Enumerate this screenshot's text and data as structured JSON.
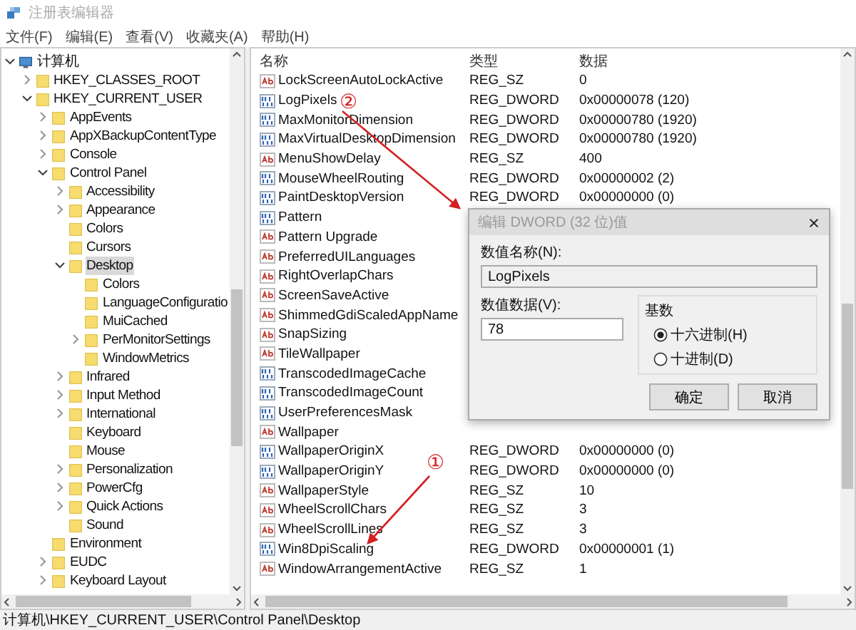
{
  "window": {
    "title": "注册表编辑器"
  },
  "menu": [
    "文件(F)",
    "编辑(E)",
    "查看(V)",
    "收藏夹(A)",
    "帮助(H)"
  ],
  "tree": {
    "label": "计算机",
    "kind": "computer",
    "expanded": true,
    "selected": false,
    "children": [
      {
        "label": "HKEY_CLASSES_ROOT",
        "expanded": false,
        "selected": false
      },
      {
        "label": "HKEY_CURRENT_USER",
        "expanded": true,
        "selected": false,
        "children": [
          {
            "label": "AppEvents",
            "expanded": false,
            "selected": false
          },
          {
            "label": "AppXBackupContentType",
            "expanded": false,
            "selected": false
          },
          {
            "label": "Console",
            "expanded": false,
            "selected": false
          },
          {
            "label": "Control Panel",
            "expanded": true,
            "selected": false,
            "children": [
              {
                "label": "Accessibility",
                "expanded": false,
                "selected": false
              },
              {
                "label": "Appearance",
                "expanded": false,
                "selected": false
              },
              {
                "label": "Colors",
                "selected": false
              },
              {
                "label": "Cursors",
                "selected": false
              },
              {
                "label": "Desktop",
                "expanded": true,
                "selected": true,
                "children": [
                  {
                    "label": "Colors",
                    "selected": false
                  },
                  {
                    "label": "LanguageConfiguratio",
                    "selected": false
                  },
                  {
                    "label": "MuiCached",
                    "selected": false
                  },
                  {
                    "label": "PerMonitorSettings",
                    "expanded": false,
                    "selected": false
                  },
                  {
                    "label": "WindowMetrics",
                    "selected": false
                  }
                ]
              },
              {
                "label": "Infrared",
                "expanded": false,
                "selected": false
              },
              {
                "label": "Input Method",
                "expanded": false,
                "selected": false
              },
              {
                "label": "International",
                "expanded": false,
                "selected": false
              },
              {
                "label": "Keyboard",
                "selected": false
              },
              {
                "label": "Mouse",
                "selected": false
              },
              {
                "label": "Personalization",
                "expanded": false,
                "selected": false
              },
              {
                "label": "PowerCfg",
                "expanded": false,
                "selected": false
              },
              {
                "label": "Quick Actions",
                "expanded": false,
                "selected": false
              },
              {
                "label": "Sound",
                "selected": false
              }
            ]
          },
          {
            "label": "Environment",
            "selected": false
          },
          {
            "label": "EUDC",
            "expanded": false,
            "selected": false
          },
          {
            "label": "Keyboard Layout",
            "expanded": false,
            "selected": false
          }
        ]
      }
    ]
  },
  "table": {
    "columns": [
      "名称",
      "类型",
      "数据"
    ],
    "rows": [
      {
        "kind": "string",
        "name": "LockScreenAutoLockActive",
        "type": "REG_SZ",
        "data": "0"
      },
      {
        "kind": "dword",
        "name": "LogPixels",
        "type": "REG_DWORD",
        "data": "0x00000078 (120)"
      },
      {
        "kind": "dword",
        "name": "MaxMonitorDimension",
        "type": "REG_DWORD",
        "data": "0x00000780 (1920)"
      },
      {
        "kind": "dword",
        "name": "MaxVirtualDesktopDimension",
        "type": "REG_DWORD",
        "data": "0x00000780 (1920)"
      },
      {
        "kind": "string",
        "name": "MenuShowDelay",
        "type": "REG_SZ",
        "data": "400"
      },
      {
        "kind": "dword",
        "name": "MouseWheelRouting",
        "type": "REG_DWORD",
        "data": "0x00000002 (2)"
      },
      {
        "kind": "dword",
        "name": "PaintDesktopVersion",
        "type": "REG_DWORD",
        "data": "0x00000000 (0)"
      },
      {
        "kind": "dword",
        "name": "Pattern"
      },
      {
        "kind": "string",
        "name": "Pattern Upgrade"
      },
      {
        "kind": "string",
        "name": "PreferredUILanguages"
      },
      {
        "kind": "string",
        "name": "RightOverlapChars"
      },
      {
        "kind": "string",
        "name": "ScreenSaveActive"
      },
      {
        "kind": "string",
        "name": "ShimmedGdiScaledAppName"
      },
      {
        "kind": "string",
        "name": "SnapSizing"
      },
      {
        "kind": "string",
        "name": "TileWallpaper"
      },
      {
        "kind": "dword",
        "name": "TranscodedImageCache"
      },
      {
        "kind": "dword",
        "name": "TranscodedImageCount"
      },
      {
        "kind": "dword",
        "name": "UserPreferencesMask"
      },
      {
        "kind": "string",
        "name": "Wallpaper"
      },
      {
        "kind": "dword",
        "name": "WallpaperOriginX",
        "type": "REG_DWORD",
        "data": "0x00000000 (0)"
      },
      {
        "kind": "dword",
        "name": "WallpaperOriginY",
        "type": "REG_DWORD",
        "data": "0x00000000 (0)"
      },
      {
        "kind": "string",
        "name": "WallpaperStyle",
        "type": "REG_SZ",
        "data": "10"
      },
      {
        "kind": "string",
        "name": "WheelScrollChars",
        "type": "REG_SZ",
        "data": "3"
      },
      {
        "kind": "string",
        "name": "WheelScrollLines",
        "type": "REG_SZ",
        "data": "3"
      },
      {
        "kind": "dword",
        "name": "Win8DpiScaling",
        "type": "REG_DWORD",
        "data": "0x00000001 (1)"
      },
      {
        "kind": "string",
        "name": "WindowArrangementActive",
        "type": "REG_SZ",
        "data": "1"
      }
    ]
  },
  "dialog": {
    "title": "编辑 DWORD (32 位)值",
    "name_label": "数值名称(N):",
    "name_value": "LogPixels",
    "data_label": "数值数据(V):",
    "data_value": "78",
    "base_label": "基数",
    "radios": [
      {
        "label": "十六进制(H)",
        "selected": true
      },
      {
        "label": "十进制(D)",
        "selected": false
      }
    ],
    "buttons": [
      "确定",
      "取消"
    ]
  },
  "annotations": [
    {
      "label": "②"
    },
    {
      "label": "①"
    }
  ],
  "status_bar": "计算机\\HKEY_CURRENT_USER\\Control Panel\\Desktop"
}
